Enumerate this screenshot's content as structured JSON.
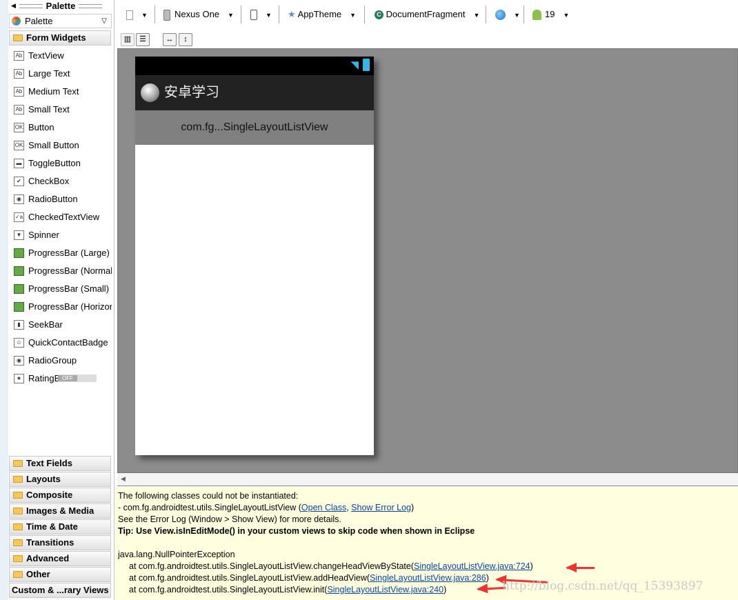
{
  "palette": {
    "title": "Palette",
    "dropdown": "Palette",
    "category_open": "Form Widgets",
    "items": [
      {
        "label": "TextView",
        "icon": "Ab"
      },
      {
        "label": "Large Text",
        "icon": "Ab"
      },
      {
        "label": "Medium Text",
        "icon": "Ab"
      },
      {
        "label": "Small Text",
        "icon": "Ab"
      },
      {
        "label": "Button",
        "icon": "OK"
      },
      {
        "label": "Small Button",
        "icon": "OK"
      },
      {
        "label": "ToggleButton",
        "icon": "▬"
      },
      {
        "label": "CheckBox",
        "icon": "✔"
      },
      {
        "label": "RadioButton",
        "icon": "◉"
      },
      {
        "label": "CheckedTextView",
        "icon": "✓a"
      },
      {
        "label": "Spinner",
        "icon": "▼"
      },
      {
        "label": "ProgressBar (Large)",
        "icon": ""
      },
      {
        "label": "ProgressBar (Normal)",
        "icon": ""
      },
      {
        "label": "ProgressBar (Small)",
        "icon": ""
      },
      {
        "label": "ProgressBar (Horizontal)",
        "icon": ""
      },
      {
        "label": "SeekBar",
        "icon": "▮"
      },
      {
        "label": "QuickContactBadge",
        "icon": "☺"
      },
      {
        "label": "RadioGroup",
        "icon": "◉"
      },
      {
        "label": "RatingBar",
        "icon": "★"
      }
    ],
    "switch_label": "OFF",
    "categories": [
      "Text Fields",
      "Layouts",
      "Composite",
      "Images & Media",
      "Time & Date",
      "Transitions",
      "Advanced",
      "Other",
      "Custom & ...rary Views"
    ]
  },
  "toolbar": {
    "device": "Nexus One",
    "theme": "AppTheme",
    "activity": "DocumentFragment",
    "api": "19"
  },
  "device": {
    "app_title": "安卓学习",
    "custom_view": "com.fg...SingleLayoutListView"
  },
  "error": {
    "line1": "The following classes could not be instantiated:",
    "line2_prefix": "- com.fg.androidtest.utils.SingleLayoutListView (",
    "open_class": "Open Class",
    "comma": ", ",
    "show_error_log": "Show Error Log",
    "close": ")",
    "line3": "See the Error Log (Window > Show View) for more details.",
    "tip": "Tip: Use View.isInEditMode() in your custom views to skip code when shown in Eclipse",
    "exception": "java.lang.NullPointerException",
    "trace": [
      {
        "at": "at com.fg.androidtest.utils.SingleLayoutListView.changeHeadViewByState(",
        "link": "SingleLayoutListView.java:724"
      },
      {
        "at": "at com.fg.androidtest.utils.SingleLayoutListView.addHeadView(",
        "link": "SingleLayoutListView.java:286"
      },
      {
        "at": "at com.fg.androidtest.utils.SingleLayoutListView.init(",
        "link": "SingleLayoutListView.java:240"
      }
    ]
  },
  "watermark": "http://blog.csdn.net/qq_15393897",
  "colors": {
    "accent": "#33b5e5",
    "arrow": "#e33333",
    "error_bg": "#ffffe0"
  }
}
